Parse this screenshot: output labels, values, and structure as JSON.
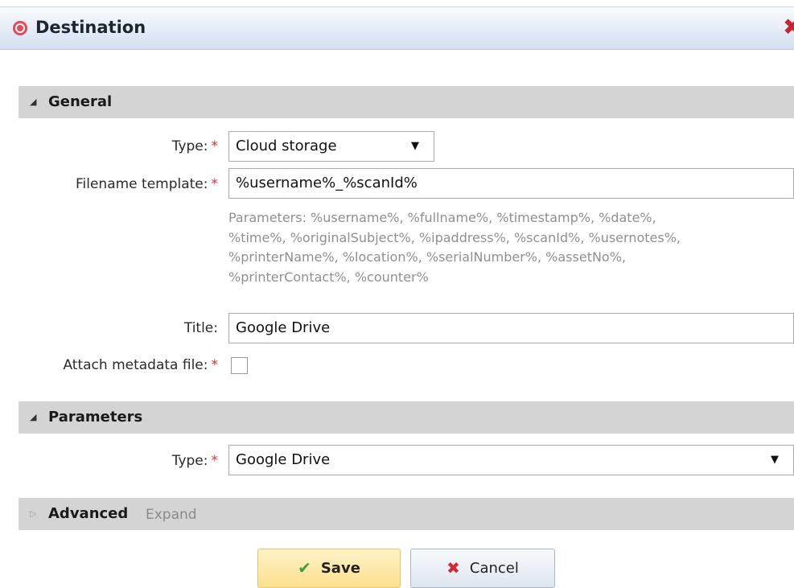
{
  "window": {
    "title": "Destination",
    "icon": "target-icon",
    "close_icon": "close-icon"
  },
  "sections": {
    "general": {
      "label": "General"
    },
    "parameters": {
      "label": "Parameters"
    },
    "advanced": {
      "label": "Advanced",
      "hint": "Expand"
    }
  },
  "general": {
    "type_label": "Type:",
    "type_value": "Cloud storage",
    "filename_label": "Filename template:",
    "filename_value": "%username%_%scanId%",
    "params_lines": [
      "Parameters: %username%, %fullname%, %timestamp%, %date%,",
      "%time%, %originalSubject%, %ipaddress%, %scanId%, %usernotes%,",
      "%printerName%, %location%, %serialNumber%, %assetNo%,",
      "%printerContact%, %counter%"
    ],
    "title_label": "Title:",
    "title_value": "Google Drive",
    "metadata_label": "Attach metadata file:",
    "metadata_checked": false,
    "required_mark": "*"
  },
  "parameters": {
    "type_label": "Type:",
    "type_value": "Google Drive"
  },
  "buttons": {
    "save": "Save",
    "cancel": "Cancel"
  },
  "colors": {
    "required": "#d9333f",
    "save_bg": "#fce08e",
    "section_bg": "#d4d4d4"
  }
}
